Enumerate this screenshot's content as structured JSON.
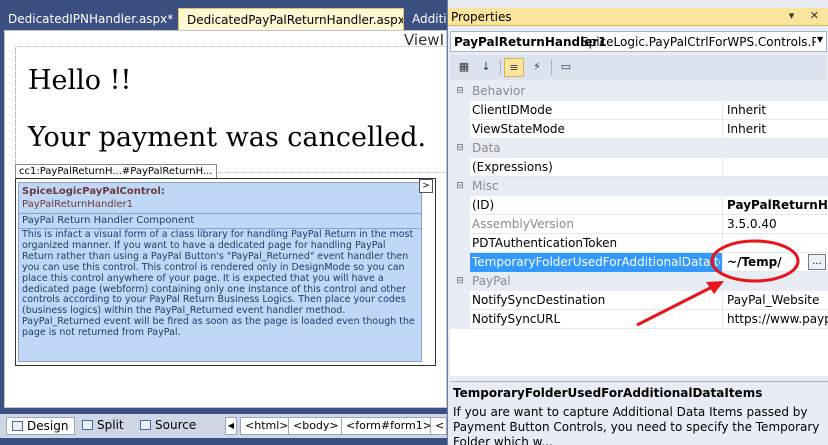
{
  "editor": {
    "tabs": [
      {
        "label": "DedicatedIPNHandler.aspx*"
      },
      {
        "label": "DedicatedPayPalReturnHandler.aspx*"
      },
      {
        "label": "Additi"
      }
    ],
    "view_label": "ViewI",
    "hello_text": "Hello !!",
    "message_text": "Your payment was cancelled.",
    "control_tag": "cc1:PayPalReturnH...#PayPalReturnH...",
    "control_panel": {
      "title": "SpiceLogicPayPalControl:",
      "name": "PayPalReturnHandler1",
      "subtitle": "PayPal Return Handler Component",
      "description": "This is infact a visual form of a class library for handling PayPal Return in the most organized manner. If you want to have a dedicated page for handling PayPal Return rather than using a PayPal Button's \"PayPal_Returned\" event handler then you can use this control. This control is rendered only in DesignMode so you can place this control anywhere of your page. It is expected that you will have a dedicated page (webform) containing only one instance of this control and other controls according to your PayPal Return Business Logics. Then place your codes (business logics) within the PayPal_Returned event handler method. PayPal_Returned event will be fired as soon as the page is loaded even though the page is not returned from PayPal.",
      "expand_glyph": ">"
    },
    "view_buttons": [
      "Design",
      "Split",
      "Source"
    ],
    "breadcrumbs": [
      "<html>",
      "<body>",
      "<form#form1>",
      "<"
    ]
  },
  "properties": {
    "title": "Properties",
    "title_icons": "▾ ✕",
    "object_name": "PayPalReturnHandler1",
    "object_type": "SpiceLogic.PayPalCtrlForWPS.Controls.PayP",
    "rows": [
      {
        "kind": "cat",
        "label": "Behavior"
      },
      {
        "kind": "prop",
        "name": "ClientIDMode",
        "value": "Inherit"
      },
      {
        "kind": "prop",
        "name": "ViewStateMode",
        "value": "Inherit"
      },
      {
        "kind": "cat",
        "label": "Data"
      },
      {
        "kind": "prop",
        "name": "(Expressions)",
        "value": ""
      },
      {
        "kind": "cat",
        "label": "Misc"
      },
      {
        "kind": "prop",
        "name": "(ID)",
        "value": "PayPalReturnHand"
      },
      {
        "kind": "prop",
        "name": "AssemblyVersion",
        "value": "3.5.0.40"
      },
      {
        "kind": "prop",
        "name": "PDTAuthenticationToken",
        "value": ""
      },
      {
        "kind": "prop",
        "name": "TemporaryFolderUsedForAdditionalDataItems",
        "value": "~/Temp/"
      },
      {
        "kind": "cat",
        "label": "PayPal"
      },
      {
        "kind": "prop",
        "name": "NotifySyncDestination",
        "value": "PayPal_Website"
      },
      {
        "kind": "prop",
        "name": "NotifySyncURL",
        "value": "https://www.paypal"
      }
    ],
    "ellipsis_label": "...",
    "description_title": "TemporaryFolderUsedForAdditionalDataItems",
    "description_text": "If you are want to capture Additional Data Items passed by Payment Button Controls, you need to specify the Temporary Folder which w..."
  },
  "colors": {
    "selection": "#3399ff",
    "annotation": "#e8141a",
    "title_bar": "#fbe59d",
    "control_panel": "#c0d8f6"
  }
}
